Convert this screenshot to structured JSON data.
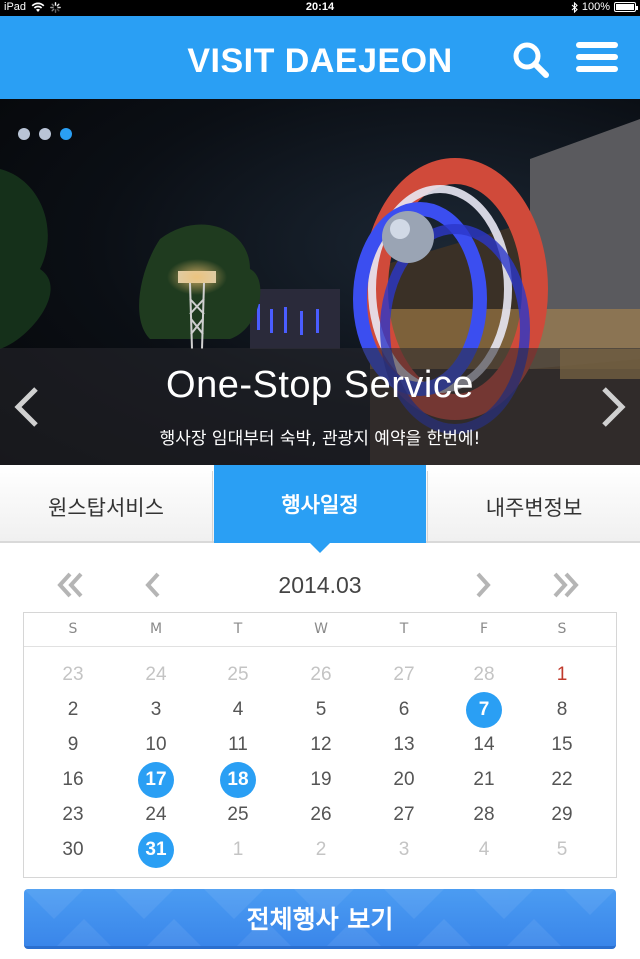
{
  "status_bar": {
    "device": "iPad",
    "time": "20:14",
    "battery": "100%"
  },
  "header": {
    "title": "VISIT DAEJEON"
  },
  "hero": {
    "slide_count": 3,
    "active_slide": 3,
    "title": "One-Stop Service",
    "subtitle": "행사장 임대부터 숙박, 관광지 예약을 한번에!"
  },
  "tabs": [
    {
      "label": "원스탑서비스",
      "active": false
    },
    {
      "label": "행사일정",
      "active": true
    },
    {
      "label": "내주변정보",
      "active": false
    }
  ],
  "calendar": {
    "month": "2014.03",
    "weekdays": [
      "S",
      "M",
      "T",
      "W",
      "T",
      "F",
      "S"
    ],
    "weeks": [
      [
        {
          "d": "23",
          "s": "muted"
        },
        {
          "d": "24",
          "s": "muted"
        },
        {
          "d": "25",
          "s": "muted"
        },
        {
          "d": "26",
          "s": "muted"
        },
        {
          "d": "27",
          "s": "muted"
        },
        {
          "d": "28",
          "s": "muted"
        },
        {
          "d": "1",
          "s": "holiday"
        }
      ],
      [
        {
          "d": "2"
        },
        {
          "d": "3"
        },
        {
          "d": "4"
        },
        {
          "d": "5"
        },
        {
          "d": "6"
        },
        {
          "d": "7",
          "s": "event"
        },
        {
          "d": "8"
        }
      ],
      [
        {
          "d": "9"
        },
        {
          "d": "10"
        },
        {
          "d": "11"
        },
        {
          "d": "12"
        },
        {
          "d": "13"
        },
        {
          "d": "14"
        },
        {
          "d": "15"
        }
      ],
      [
        {
          "d": "16"
        },
        {
          "d": "17",
          "s": "event"
        },
        {
          "d": "18",
          "s": "event"
        },
        {
          "d": "19"
        },
        {
          "d": "20"
        },
        {
          "d": "21"
        },
        {
          "d": "22"
        }
      ],
      [
        {
          "d": "23"
        },
        {
          "d": "24"
        },
        {
          "d": "25"
        },
        {
          "d": "26"
        },
        {
          "d": "27"
        },
        {
          "d": "28"
        },
        {
          "d": "29"
        }
      ],
      [
        {
          "d": "30"
        },
        {
          "d": "31",
          "s": "event"
        },
        {
          "d": "1",
          "s": "muted"
        },
        {
          "d": "2",
          "s": "muted"
        },
        {
          "d": "3",
          "s": "muted"
        },
        {
          "d": "4",
          "s": "muted"
        },
        {
          "d": "5",
          "s": "muted"
        }
      ]
    ]
  },
  "button": {
    "label": "전체행사 보기"
  },
  "colors": {
    "accent": "#2a9ff4",
    "holiday": "#c0392b",
    "muted_day": "#c4c4c4"
  }
}
